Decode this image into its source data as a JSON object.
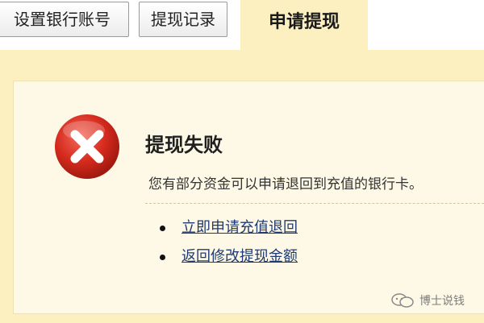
{
  "tabs": {
    "items": [
      {
        "label": "设置银行账号"
      },
      {
        "label": "提现记录"
      }
    ],
    "active": {
      "label": "申请提现"
    }
  },
  "result": {
    "icon": "error-x-icon",
    "title": "提现失败",
    "message": "您有部分资金可以申请退回到充值的银行卡。"
  },
  "actions": [
    {
      "label": "立即申请充值退回"
    },
    {
      "label": "返回修改提现金额"
    }
  ],
  "watermark": {
    "icon": "wechat-icon",
    "text": "博士说钱"
  },
  "colors": {
    "tab_active_bg": "#fcefc0",
    "panel_bg": "#fdf9e6",
    "error_red": "#d52a1d",
    "link": "#1f3a73"
  }
}
